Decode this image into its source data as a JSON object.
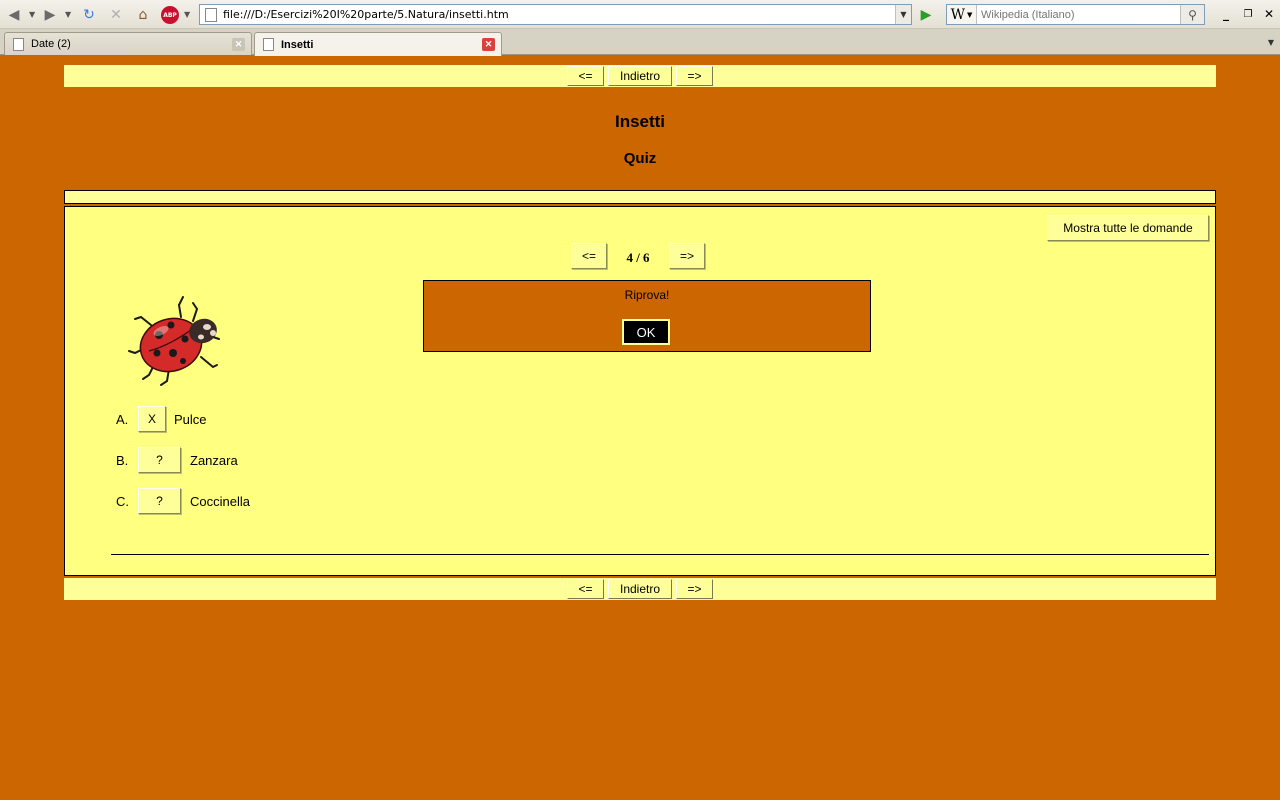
{
  "browser": {
    "url": "file:///D:/Esercizi%20I%20parte/5.Natura/insetti.htm",
    "search_placeholder": "Wikipedia (Italiano)",
    "search_engine_glyph": "W",
    "tabs": [
      {
        "label": "Date (2)",
        "active": false
      },
      {
        "label": "Insetti",
        "active": true
      }
    ],
    "addon_badge": "ABP"
  },
  "nav": {
    "prev_label": "<=",
    "back_label": "Indietro",
    "next_label": "=>"
  },
  "page": {
    "title": "Insetti",
    "subtitle": "Quiz"
  },
  "quiz": {
    "show_all_label": "Mostra tutte le domande",
    "prev_label": "<=",
    "next_label": "=>",
    "counter": "4 / 6",
    "feedback": {
      "message": "Riprova!",
      "ok_label": "OK"
    },
    "image_subject": "ladybug",
    "answers": [
      {
        "letter": "A.",
        "button": "X",
        "text": "Pulce"
      },
      {
        "letter": "B.",
        "button": "?",
        "text": "Zanzara"
      },
      {
        "letter": "C.",
        "button": "?",
        "text": "Coccinella"
      }
    ]
  },
  "colors": {
    "page_background": "#cc6600",
    "panel_background": "#ffff80",
    "nav_background": "#ffff99",
    "feedback_background": "#cc6600",
    "ok_button": "#000000"
  }
}
